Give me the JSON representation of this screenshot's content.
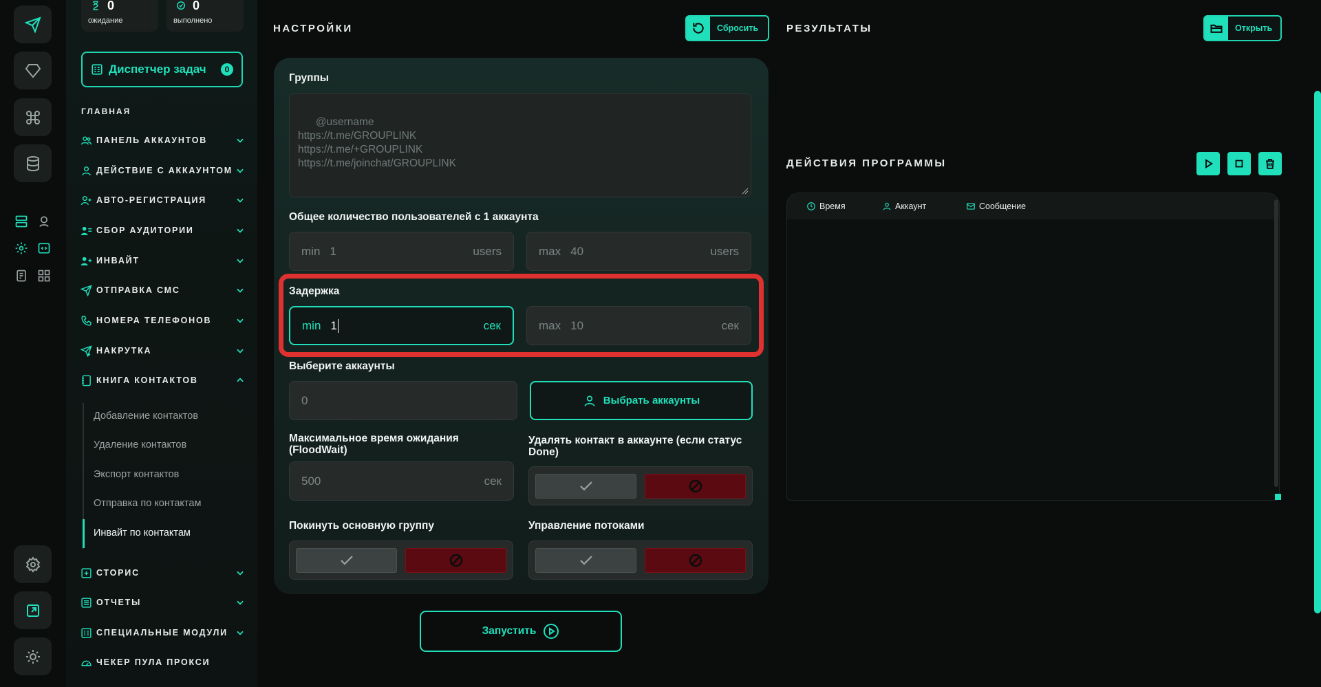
{
  "stats": {
    "waiting": {
      "count": "0",
      "label": "ожидание"
    },
    "done": {
      "count": "0",
      "label": "выполнено"
    }
  },
  "task_manager": {
    "label": "Диспетчер задач",
    "badge": "0"
  },
  "nav": {
    "section": "ГЛАВНАЯ",
    "items": [
      {
        "label": "ПАНЕЛЬ АККАУНТОВ",
        "icon": "users-icon"
      },
      {
        "label": "ДЕЙСТВИЕ С АККАУНТОМ",
        "icon": "user-icon"
      },
      {
        "label": "АВТО-РЕГИСТРАЦИЯ",
        "icon": "user-plus-icon"
      },
      {
        "label": "СБОР АУДИТОРИИ",
        "icon": "user-list-icon"
      },
      {
        "label": "ИНВАЙТ",
        "icon": "user-add-icon"
      },
      {
        "label": "ОТПРАВКА СМС",
        "icon": "paper-plane-icon"
      },
      {
        "label": "НОМЕРА ТЕЛЕФОНОВ",
        "icon": "phone-icon"
      },
      {
        "label": "НАКРУТКА",
        "icon": "send-up-icon"
      },
      {
        "label": "КНИГА КОНТАКТОВ",
        "icon": "contacts-book-icon"
      },
      {
        "label": "СТОРИС",
        "icon": "plus-square-icon"
      },
      {
        "label": "ОТЧЕТЫ",
        "icon": "report-icon"
      },
      {
        "label": "СПЕЦИАЛЬНЫЕ МОДУЛИ",
        "icon": "modules-icon"
      },
      {
        "label": "ЧЕКЕР ПУЛА ПРОКСИ",
        "icon": "gauge-icon"
      }
    ],
    "contacts_sub": [
      "Добавление контактов",
      "Удаление контактов",
      "Экспорт контактов",
      "Отправка по контактам",
      "Инвайт по контактам"
    ]
  },
  "settings": {
    "title": "НАСТРОЙКИ",
    "reset_label": "Сбросить",
    "groups": {
      "label": "Группы",
      "placeholder": "@username\nhttps://t.me/GROUPLINK\nhttps://t.me/+GROUPLINK\nhttps://t.me/joinchat/GROUPLINK"
    },
    "users_total": {
      "label": "Общее количество пользователей с 1 аккаунта",
      "min_prefix": "min",
      "min_value": "1",
      "min_unit": "users",
      "max_prefix": "max",
      "max_value": "40",
      "max_unit": "users"
    },
    "delay": {
      "label": "Задержка",
      "min_prefix": "min",
      "min_value": "1",
      "min_unit": "сек",
      "max_prefix": "max",
      "max_value": "10",
      "max_unit": "сек"
    },
    "accounts": {
      "label": "Выберите аккаунты",
      "count": "0",
      "select_label": "Выбрать аккаунты"
    },
    "floodwait": {
      "label_line1": "Максимальное время ожидания",
      "label_line2": "(FloodWait)",
      "value": "500",
      "unit": "сек"
    },
    "delete_contact": {
      "label_line1": "Удалять контакт в аккаунте (если статус",
      "label_line2": "Done)"
    },
    "leave_group": {
      "label": "Покинуть основную группу"
    },
    "threads": {
      "label": "Управление потоками"
    }
  },
  "run_label": "Запустить",
  "results": {
    "title": "РЕЗУЛЬТАТЫ",
    "open_label": "Открыть"
  },
  "program_actions": {
    "title": "ДЕЙСТВИЯ ПРОГРАММЫ",
    "columns": [
      "Время",
      "Аккаунт",
      "Сообщение"
    ]
  },
  "colors": {
    "accent": "#20e0bb",
    "danger": "#5a0a10",
    "highlight": "#e03131"
  }
}
